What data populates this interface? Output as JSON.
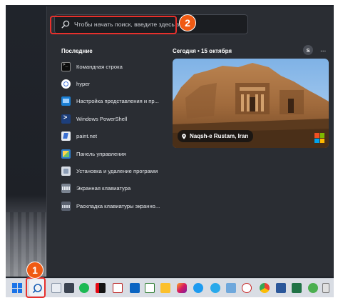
{
  "search": {
    "placeholder": "Чтобы начать поиск, введите здесь запрос"
  },
  "recent": {
    "title": "Последние",
    "items": [
      {
        "label": "Командная строка",
        "icon": "cmd-icon"
      },
      {
        "label": "hyper",
        "icon": "hyper-icon"
      },
      {
        "label": "Настройка представления и пр...",
        "icon": "settings-window-icon"
      },
      {
        "label": "Windows PowerShell",
        "icon": "powershell-icon"
      },
      {
        "label": "paint.net",
        "icon": "paint-icon"
      },
      {
        "label": "Панель управления",
        "icon": "control-panel-icon"
      },
      {
        "label": "Установка и удаление программ",
        "icon": "install-programs-icon"
      },
      {
        "label": "Экранная клавиатура",
        "icon": "on-screen-keyboard-icon"
      },
      {
        "label": "Раскладка клавиатуры экранно...",
        "icon": "keyboard-layout-icon"
      }
    ]
  },
  "today": {
    "title": "Сегодня  •  15 октября",
    "avatar_initial": "S",
    "more": "...",
    "location": "Naqsh-e Rustam, Iran"
  },
  "annotations": {
    "step1": "1",
    "step2": "2",
    "color": "#e8302c",
    "badge_color": "#f05a13"
  },
  "taskbar": {
    "icons": [
      "start-icon",
      "search-icon",
      "file-explorer-icon",
      "calculator-icon",
      "spotify-icon",
      "netflix-icon",
      "mail-icon",
      "calendar-icon",
      "notes-icon",
      "instagram-icon",
      "twitter-icon",
      "telegram-icon",
      "photos-icon",
      "media-icon",
      "chrome-icon",
      "word-icon",
      "excel-icon",
      "maps-icon"
    ]
  },
  "colors": {
    "panel": "#2a2d33",
    "accent": "#1a73e8"
  }
}
